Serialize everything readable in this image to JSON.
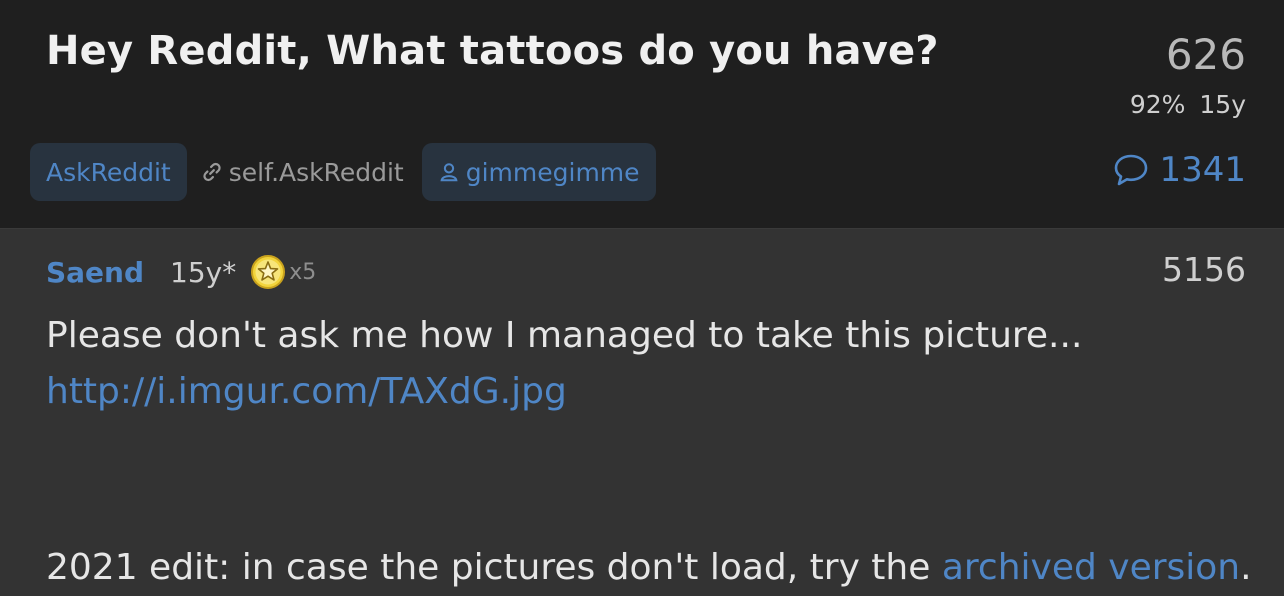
{
  "post": {
    "title": "Hey Reddit, What tattoos do you have?",
    "score": "626",
    "upvote_ratio": "92%",
    "age": "15y",
    "subreddit": "AskReddit",
    "domain": "self.AskReddit",
    "author": "gimmegimme",
    "comment_count": "1341"
  },
  "comment": {
    "author": "Saend",
    "age": "15y*",
    "award_count": "x5",
    "score": "5156",
    "body_text": "Please don't ask me how I managed to take this picture... ",
    "link_text": "http://i.imgur.com/TAXdG.jpg",
    "edit_text": "2021 edit: in case the pictures don't load, try the ",
    "edit_link": "archived version",
    "edit_end": "."
  },
  "colors": {
    "accent": "#4f86c6",
    "header_bg": "#1f1f1f",
    "body_bg": "#333333",
    "award_gold": "#f2d43c"
  },
  "icons": [
    "link-icon",
    "user-icon",
    "comment-bubble-icon",
    "award-star-icon"
  ]
}
